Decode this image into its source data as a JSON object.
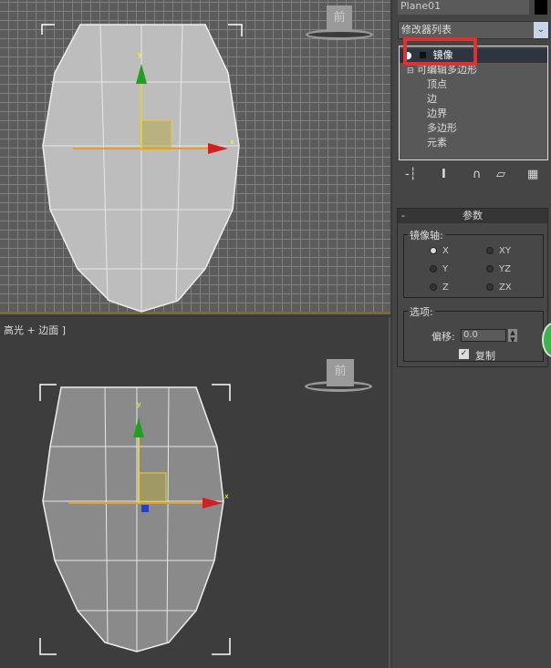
{
  "panel": {
    "object_name": "Plane01",
    "modifier_list": "修改器列表",
    "stack": [
      {
        "label": "镜像",
        "selected": true,
        "highlighted": true
      },
      {
        "label": "可编辑多边形"
      },
      {
        "label": "顶点"
      },
      {
        "label": "边"
      },
      {
        "label": "边界"
      },
      {
        "label": "多边形"
      },
      {
        "label": "元素"
      }
    ],
    "toolbar_icons": [
      "pin-stack-icon",
      "show-end-result-icon",
      "make-unique-icon",
      "remove-modifier-icon",
      "configure-sets-icon"
    ],
    "rollout": {
      "collapse": "-",
      "title": "参数",
      "mirror_axis_label": "镜像轴:",
      "axes": [
        "X",
        "Y",
        "Z",
        "XY",
        "YZ",
        "ZX"
      ],
      "selected_axis": "X",
      "options_label": "选项:",
      "offset_label": "偏移:",
      "offset_value": "0.0",
      "copy_label": "复制",
      "copy_checked": true
    },
    "highlight_color": "#e03030"
  },
  "viewports": {
    "top": {
      "cube_label": "前"
    },
    "bottom": {
      "label": "高光 + 边面 ]",
      "cube_label": "前"
    }
  },
  "gizmo": {
    "x_label": "x",
    "y_label": "y"
  }
}
